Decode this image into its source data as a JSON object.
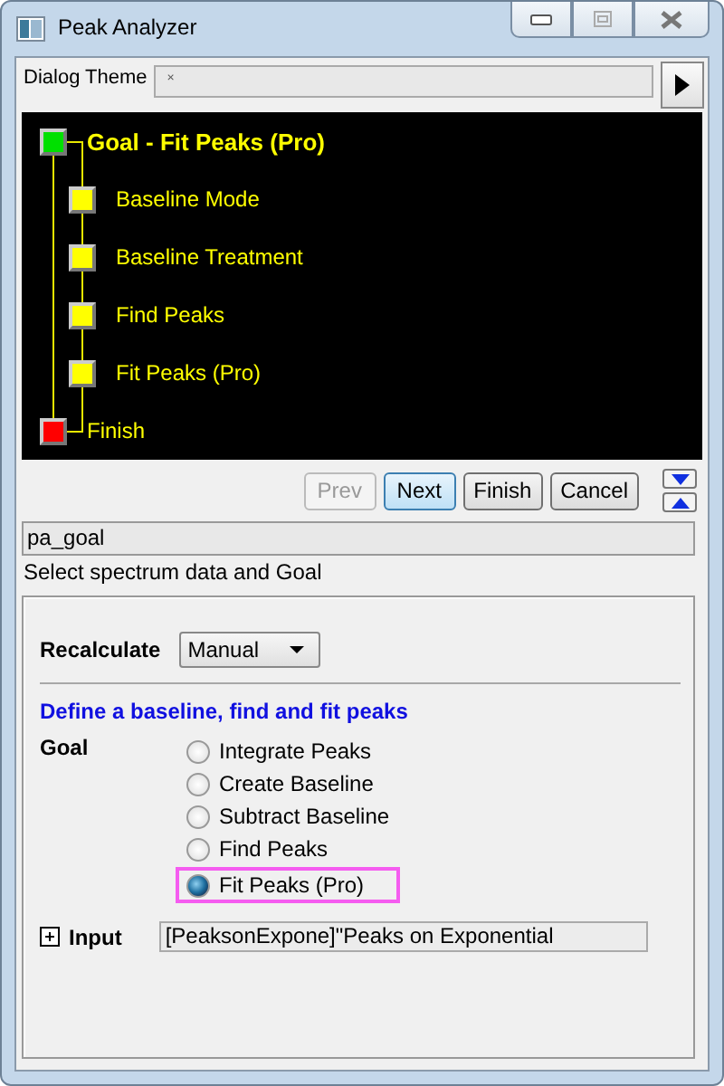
{
  "window": {
    "title": "Peak Analyzer"
  },
  "theme": {
    "label": "Dialog Theme",
    "value": "×"
  },
  "steps": [
    {
      "label": "Goal - Fit Peaks (Pro)",
      "kind": "root",
      "color": "#00e000"
    },
    {
      "label": "Baseline Mode",
      "kind": "child",
      "color": "#ffff00"
    },
    {
      "label": "Baseline Treatment",
      "kind": "child",
      "color": "#ffff00"
    },
    {
      "label": "Find Peaks",
      "kind": "child",
      "color": "#ffff00"
    },
    {
      "label": "Fit Peaks (Pro)",
      "kind": "child",
      "color": "#ffff00"
    },
    {
      "label": "Finish",
      "kind": "end",
      "color": "#ff0000"
    }
  ],
  "nav_buttons": [
    {
      "label": "Prev",
      "disabled": true,
      "default": false
    },
    {
      "label": "Next",
      "disabled": false,
      "default": true
    },
    {
      "label": "Finish",
      "disabled": false,
      "default": false
    },
    {
      "label": "Cancel",
      "disabled": false,
      "default": false
    }
  ],
  "page_name": "pa_goal",
  "description": "Select spectrum data and Goal",
  "recalculate": {
    "label": "Recalculate",
    "value": "Manual"
  },
  "section_title": "Define a baseline, find and fit peaks",
  "goal": {
    "label": "Goal",
    "options": [
      {
        "label": "Integrate Peaks",
        "selected": false
      },
      {
        "label": "Create Baseline",
        "selected": false
      },
      {
        "label": "Subtract Baseline",
        "selected": false
      },
      {
        "label": "Find Peaks",
        "selected": false
      },
      {
        "label": "Fit Peaks (Pro)",
        "selected": true
      }
    ]
  },
  "input": {
    "label": "Input",
    "expanded": false,
    "value": "[PeaksonExpone]\"Peaks on Exponential"
  }
}
